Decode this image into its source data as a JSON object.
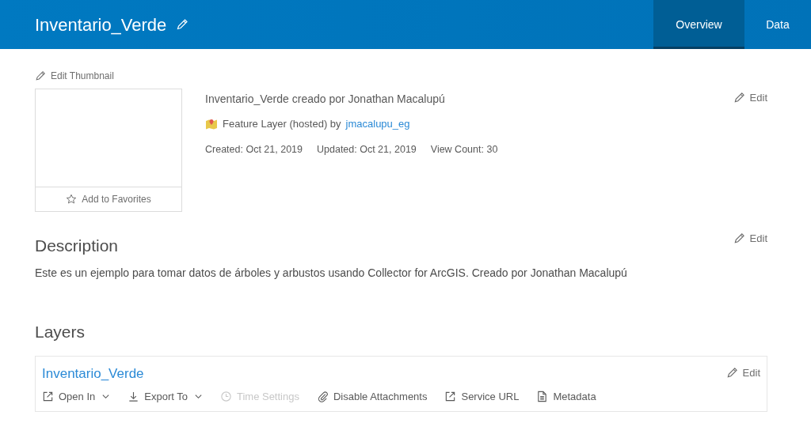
{
  "header": {
    "title": "Inventario_Verde",
    "tabs": [
      {
        "label": "Overview",
        "selected": true
      },
      {
        "label": "Data",
        "selected": false
      }
    ]
  },
  "thumbnail": {
    "edit_label": "Edit Thumbnail",
    "favorites_label": "Add to Favorites"
  },
  "summary": {
    "text": "Inventario_Verde creado por Jonathan Macalupú",
    "type_label": "Feature Layer (hosted) by",
    "owner": "jmacalupu_eg",
    "created": "Created: Oct 21, 2019",
    "updated": "Updated: Oct 21, 2019",
    "views": "View Count: 30",
    "edit_label": "Edit"
  },
  "description": {
    "heading": "Description",
    "edit_label": "Edit",
    "text": "Este es un ejemplo para tomar datos de árboles y arbustos usando Collector for ArcGIS. Creado por Jonathan Macalupú"
  },
  "layers": {
    "heading": "Layers",
    "items": [
      {
        "name": "Inventario_Verde",
        "edit_label": "Edit",
        "actions": [
          {
            "kind": "external",
            "label": "Open In",
            "dropdown": true,
            "disabled": false
          },
          {
            "kind": "download",
            "label": "Export To",
            "dropdown": true,
            "disabled": false
          },
          {
            "kind": "clock",
            "label": "Time Settings",
            "dropdown": false,
            "disabled": true
          },
          {
            "kind": "clip",
            "label": "Disable Attachments",
            "dropdown": false,
            "disabled": false
          },
          {
            "kind": "external",
            "label": "Service URL",
            "dropdown": false,
            "disabled": false
          },
          {
            "kind": "doc",
            "label": "Metadata",
            "dropdown": false,
            "disabled": false
          }
        ]
      }
    ]
  }
}
